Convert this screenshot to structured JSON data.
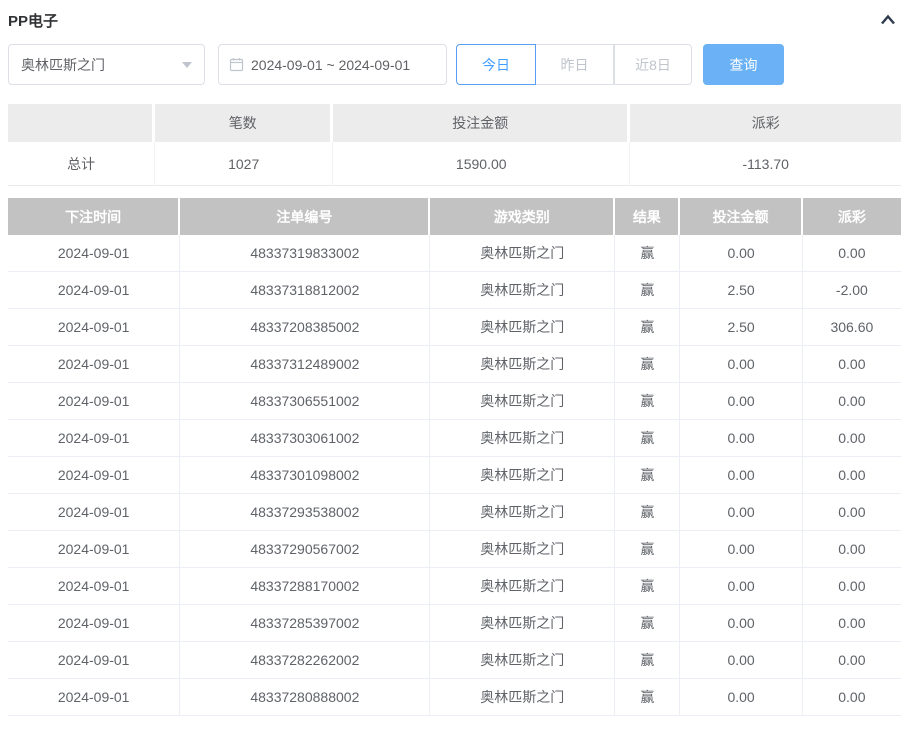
{
  "colors": {
    "primary_fill": "#6ab2f5",
    "primary_text": "#409eff",
    "negative": "#f56c6c",
    "table_header_bg": "#c2c2c2",
    "summary_header_bg": "#ececec",
    "body_text": "#606266",
    "title_text": "#303133"
  },
  "panel": {
    "title": "PP电子",
    "collapse_icon": "chevron-up-icon"
  },
  "filters": {
    "game_select": {
      "value": "奥林匹斯之门"
    },
    "date_range": {
      "value": "2024-09-01 ~ 2024-09-01"
    },
    "quick_buttons": [
      {
        "label": "今日",
        "active": true
      },
      {
        "label": "昨日",
        "active": false
      },
      {
        "label": "近8日",
        "active": false
      }
    ],
    "query_button_label": "查询"
  },
  "summary": {
    "headers": [
      "",
      "笔数",
      "投注金额",
      "派彩"
    ],
    "row_label": "总计",
    "count": "1027",
    "bet_amount": "1590.00",
    "payout": "-113.70"
  },
  "table": {
    "headers": [
      "下注时间",
      "注单编号",
      "游戏类别",
      "结果",
      "投注金额",
      "派彩"
    ],
    "rows": [
      {
        "date": "2024-09-01",
        "order": "48337319833002",
        "game": "奥林匹斯之门",
        "result": "赢",
        "bet": "0.00",
        "payout": "0.00"
      },
      {
        "date": "2024-09-01",
        "order": "48337318812002",
        "game": "奥林匹斯之门",
        "result": "赢",
        "bet": "2.50",
        "payout": "-2.00"
      },
      {
        "date": "2024-09-01",
        "order": "48337208385002",
        "game": "奥林匹斯之门",
        "result": "赢",
        "bet": "2.50",
        "payout": "306.60"
      },
      {
        "date": "2024-09-01",
        "order": "48337312489002",
        "game": "奥林匹斯之门",
        "result": "赢",
        "bet": "0.00",
        "payout": "0.00"
      },
      {
        "date": "2024-09-01",
        "order": "48337306551002",
        "game": "奥林匹斯之门",
        "result": "赢",
        "bet": "0.00",
        "payout": "0.00"
      },
      {
        "date": "2024-09-01",
        "order": "48337303061002",
        "game": "奥林匹斯之门",
        "result": "赢",
        "bet": "0.00",
        "payout": "0.00"
      },
      {
        "date": "2024-09-01",
        "order": "48337301098002",
        "game": "奥林匹斯之门",
        "result": "赢",
        "bet": "0.00",
        "payout": "0.00"
      },
      {
        "date": "2024-09-01",
        "order": "48337293538002",
        "game": "奥林匹斯之门",
        "result": "赢",
        "bet": "0.00",
        "payout": "0.00"
      },
      {
        "date": "2024-09-01",
        "order": "48337290567002",
        "game": "奥林匹斯之门",
        "result": "赢",
        "bet": "0.00",
        "payout": "0.00"
      },
      {
        "date": "2024-09-01",
        "order": "48337288170002",
        "game": "奥林匹斯之门",
        "result": "赢",
        "bet": "0.00",
        "payout": "0.00"
      },
      {
        "date": "2024-09-01",
        "order": "48337285397002",
        "game": "奥林匹斯之门",
        "result": "赢",
        "bet": "0.00",
        "payout": "0.00"
      },
      {
        "date": "2024-09-01",
        "order": "48337282262002",
        "game": "奥林匹斯之门",
        "result": "赢",
        "bet": "0.00",
        "payout": "0.00"
      },
      {
        "date": "2024-09-01",
        "order": "48337280888002",
        "game": "奥林匹斯之门",
        "result": "赢",
        "bet": "0.00",
        "payout": "0.00"
      }
    ]
  }
}
